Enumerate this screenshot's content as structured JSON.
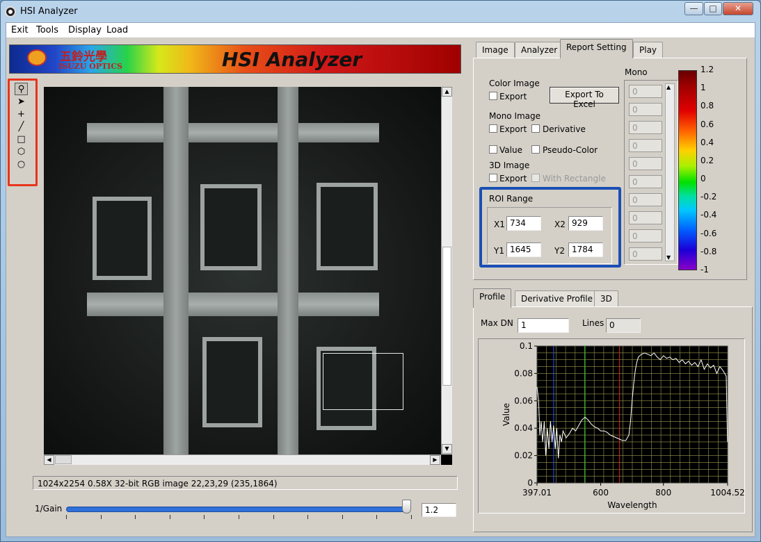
{
  "window": {
    "title": "HSI Analyzer",
    "min": "—",
    "max": "□",
    "close": "✕"
  },
  "menu": [
    "Exit",
    "Tools",
    "Display",
    "Load"
  ],
  "banner": {
    "title": "HSI Analyzer",
    "logo_cn": "五鈴光學",
    "logo_en": "ISUZU OPTICS"
  },
  "tools": [
    {
      "name": "zoom-tool-icon",
      "glyph": "⚲"
    },
    {
      "name": "pointer-tool-icon",
      "glyph": "➤"
    },
    {
      "name": "crosshair-tool-icon",
      "glyph": "+"
    },
    {
      "name": "line-tool-icon",
      "glyph": "╱"
    },
    {
      "name": "rectangle-tool-icon",
      "glyph": "□"
    },
    {
      "name": "polygon-tool-icon",
      "glyph": "⬡"
    },
    {
      "name": "ellipse-tool-icon",
      "glyph": "○"
    }
  ],
  "image": {
    "status": "1024x2254 0.58X 32-bit RGB image 22,23,29     (235,1864)"
  },
  "gain": {
    "label": "1/Gain",
    "value": "1.2",
    "fraction": 0.99
  },
  "top_tabs": [
    "Image",
    "Analyzer",
    "Report Setting",
    "Play"
  ],
  "report": {
    "color_image": "Color Image",
    "export": "Export",
    "export_excel": "Export To Excel",
    "mono_image": "Mono Image",
    "derivative": "Derivative",
    "value": "Value",
    "pseudo_color": "Pseudo-Color",
    "image_3d": "3D Image",
    "with_rectangle": "With Rectangle",
    "roi_range": "ROI Range",
    "x1_label": "X1",
    "x1": "734",
    "x2_label": "X2",
    "x2": "929",
    "y1_label": "Y1",
    "y1": "1645",
    "y2_label": "Y2",
    "y2": "1784",
    "mono_label": "Mono",
    "mono_values": [
      "0",
      "0",
      "0",
      "0",
      "0",
      "0",
      "0",
      "0",
      "0",
      "0"
    ]
  },
  "colorbar_ticks": [
    "1.2",
    "1",
    "0.8",
    "0.6",
    "0.4",
    "0.2",
    "0",
    "-0.2",
    "-0.4",
    "-0.6",
    "-0.8",
    "-1"
  ],
  "bottom_tabs": [
    "Profile",
    "Derivative Profile",
    "3D"
  ],
  "profile": {
    "max_dn_label": "Max DN",
    "max_dn": "1",
    "lines_label": "Lines",
    "lines": "0"
  },
  "chart_data": {
    "type": "line",
    "xlabel": "Wavelength",
    "ylabel": "Value",
    "xlim": [
      397.01,
      1004.52
    ],
    "ylim": [
      0,
      0.1
    ],
    "x_ticks": [
      "397.01",
      "600",
      "800",
      "1004.52"
    ],
    "y_ticks": [
      "0.1",
      "0.08",
      "0.06",
      "0.04",
      "0.02",
      "0"
    ],
    "grid": true,
    "markers": [
      {
        "x": 450,
        "color": "#3050ff"
      },
      {
        "x": 550,
        "color": "#30d030"
      },
      {
        "x": 660,
        "color": "#e02020"
      }
    ],
    "series": [
      {
        "color": "#ffffff",
        "x": [
          397,
          402,
          406,
          410,
          415,
          420,
          425,
          430,
          435,
          440,
          445,
          450,
          455,
          460,
          465,
          470,
          475,
          480,
          490,
          500,
          510,
          520,
          530,
          540,
          550,
          560,
          570,
          580,
          590,
          600,
          610,
          620,
          630,
          640,
          650,
          660,
          670,
          680,
          690,
          695,
          700,
          705,
          710,
          715,
          720,
          730,
          740,
          750,
          760,
          770,
          780,
          790,
          800,
          810,
          820,
          830,
          840,
          850,
          860,
          870,
          880,
          890,
          900,
          910,
          920,
          930,
          940,
          950,
          960,
          970,
          980,
          990,
          1000,
          1004
        ],
        "values": [
          0.07,
          0.06,
          0.035,
          0.045,
          0.03,
          0.045,
          0.02,
          0.04,
          0.025,
          0.045,
          0.03,
          0.042,
          0.025,
          0.04,
          0.018,
          0.035,
          0.03,
          0.038,
          0.033,
          0.036,
          0.04,
          0.038,
          0.042,
          0.046,
          0.048,
          0.046,
          0.043,
          0.041,
          0.04,
          0.038,
          0.038,
          0.037,
          0.035,
          0.034,
          0.033,
          0.032,
          0.031,
          0.031,
          0.035,
          0.045,
          0.06,
          0.072,
          0.082,
          0.088,
          0.092,
          0.094,
          0.095,
          0.094,
          0.093,
          0.095,
          0.092,
          0.09,
          0.093,
          0.091,
          0.092,
          0.09,
          0.091,
          0.088,
          0.09,
          0.087,
          0.089,
          0.086,
          0.088,
          0.085,
          0.09,
          0.083,
          0.087,
          0.084,
          0.086,
          0.08,
          0.085,
          0.082,
          0.078,
          0.03
        ]
      }
    ]
  }
}
